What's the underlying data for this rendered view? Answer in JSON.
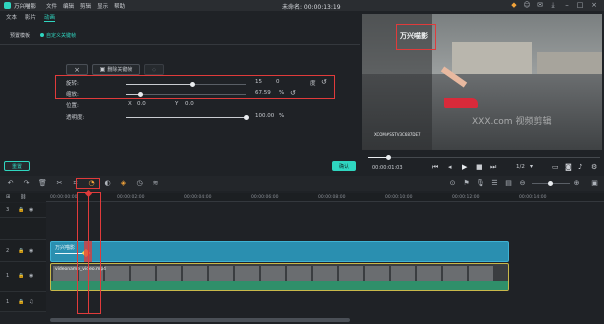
{
  "app": {
    "name": "万兴喵影",
    "menus": [
      "文件",
      "编辑",
      "剪辑",
      "显示",
      "帮助"
    ],
    "project_title": "未命名: 00:00:13:19"
  },
  "tabs": [
    "文本",
    "影片",
    "动画"
  ],
  "active_tab_index": 2,
  "subtabs": [
    {
      "label": "预置模板",
      "active": false
    },
    {
      "label": "自定义关键帧",
      "active": true
    }
  ],
  "keyframe_toolbar": {
    "add_label": "",
    "delete_label": "删除关键帧",
    "extra_label": ""
  },
  "controls": {
    "rotate": {
      "label": "旋转:",
      "value": "15",
      "deg_value": "0",
      "unit": "度"
    },
    "scale": {
      "label": "缩放:",
      "value": "67.59",
      "unit": "%"
    },
    "position": {
      "label": "位置:",
      "x_label": "X",
      "x_value": "0.0",
      "y_label": "Y",
      "y_value": "0.0"
    },
    "opacity": {
      "label": "透明度:",
      "value": "100.00",
      "unit": "%"
    }
  },
  "slider_levels": {
    "rotate_fraction": 0.55,
    "scale_fraction": 0.12,
    "opacity_fraction": 1.0
  },
  "buttons": {
    "reset": "重置",
    "ok": "确认"
  },
  "preview": {
    "overlay_text": "万兴喵影",
    "watermark": "XXX.com 视频剪辑",
    "small_caption": "XCOM#SSTV3C687DE7"
  },
  "playback": {
    "timecode": "00:00:01:03",
    "ratio": "1/2"
  },
  "timeline": {
    "ticks": [
      "00:00:00:00",
      "00:00:02:00",
      "00:00:04:00",
      "00:00:06:00",
      "00:00:08:00",
      "00:00:10:00",
      "00:00:12:00",
      "00:00:14:00"
    ],
    "track_numbers": [
      "3",
      "2",
      "1",
      "1"
    ],
    "text_clip_label": "万兴喵影",
    "video_clip_label": "videoname_video.mp4"
  },
  "colors": {
    "accent": "#2fd6c0",
    "highlight_red": "#e03b3b",
    "text_clip": "#2a8fb0",
    "video_border": "#c8b84a"
  }
}
